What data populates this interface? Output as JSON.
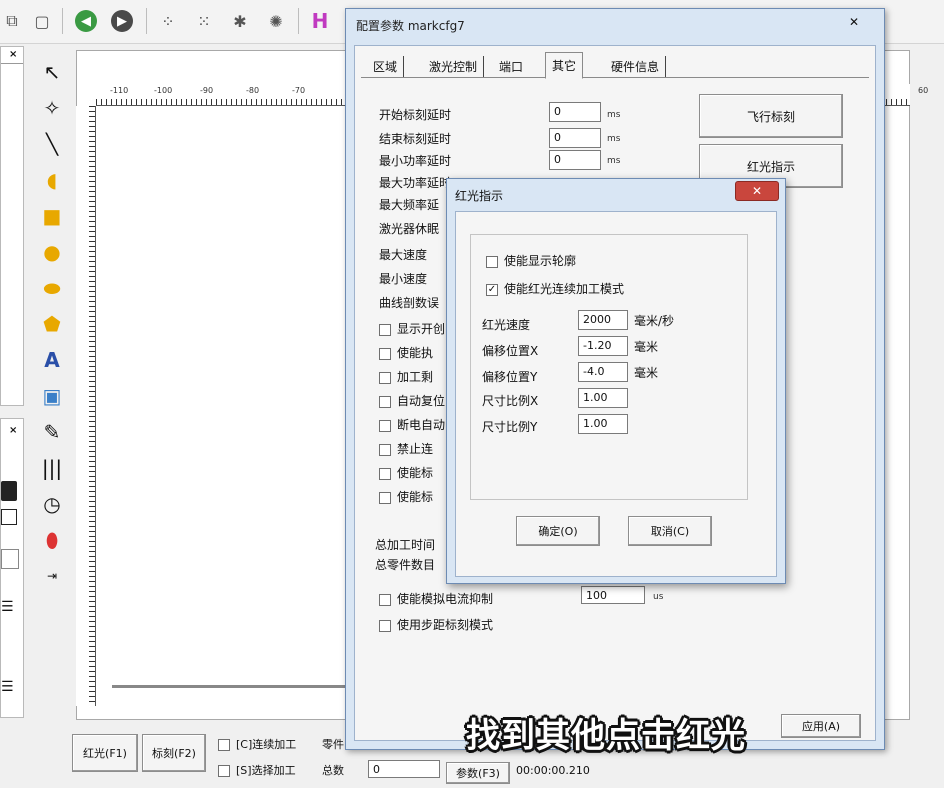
{
  "config_dialog": {
    "title": "配置参数 markcfg7",
    "tabs": [
      "区域",
      "激光控制",
      "端口",
      "其它",
      "硬件信息"
    ],
    "active_tab": "其它",
    "params": [
      {
        "label": "开始标刻延时",
        "value": "0",
        "unit": "ms"
      },
      {
        "label": "结束标刻延时",
        "value": "0",
        "unit": "ms"
      },
      {
        "label": "最小功率延时",
        "value": "0",
        "unit": "ms"
      },
      {
        "label": "最大功率延时",
        "value": "",
        "unit": ""
      },
      {
        "label": "最大频率延",
        "value": "",
        "unit": ""
      },
      {
        "label": "激光器休眠",
        "value": "",
        "unit": ""
      }
    ],
    "speed_labels": [
      "最大速度",
      "最小速度",
      "曲线剖数误"
    ],
    "checkboxes": [
      "显示开创",
      "使能执",
      "加工剩",
      "自动复位",
      "断电自动",
      "禁止连",
      "使能标",
      "使能标"
    ],
    "total_time_label": "总加工时间",
    "total_parts_label": "总零件数目",
    "analog_label": "使能模拟电流抑制",
    "analog_value": "100",
    "analog_unit": "us",
    "step_mode_label": "使用步距标刻模式",
    "fly_mark_button": "飞行标刻",
    "red_light_button": "红光指示",
    "apply_button": "应用(A)"
  },
  "red_dialog": {
    "title": "红光指示",
    "show_outline": "使能显示轮廓",
    "continuous_mode": "使能红光连续加工模式",
    "fields": [
      {
        "label": "红光速度",
        "value": "2000",
        "unit": "毫米/秒"
      },
      {
        "label": "偏移位置X",
        "value": "-1.20",
        "unit": "毫米"
      },
      {
        "label": "偏移位置Y",
        "value": "-4.0",
        "unit": "毫米"
      },
      {
        "label": "尺寸比例X",
        "value": "1.00",
        "unit": ""
      },
      {
        "label": "尺寸比例Y",
        "value": "1.00",
        "unit": ""
      }
    ],
    "ok_button": "确定(O)",
    "cancel_button": "取消(C)"
  },
  "ruler_ticks": [
    "-110",
    "-100",
    "-90",
    "-80",
    "-70",
    "60"
  ],
  "bottom": {
    "red_button": "红光(F1)",
    "mark_button": "标刻(F2)",
    "continuous_label": "[C]连续加工",
    "parts_label": "零件",
    "select_label": "[S]选择加工",
    "total_label": "总数",
    "total_value": "0",
    "params_button": "参数(F3)",
    "elapsed": "00:00:00.210"
  },
  "subtitle": "找到其他点击红光"
}
